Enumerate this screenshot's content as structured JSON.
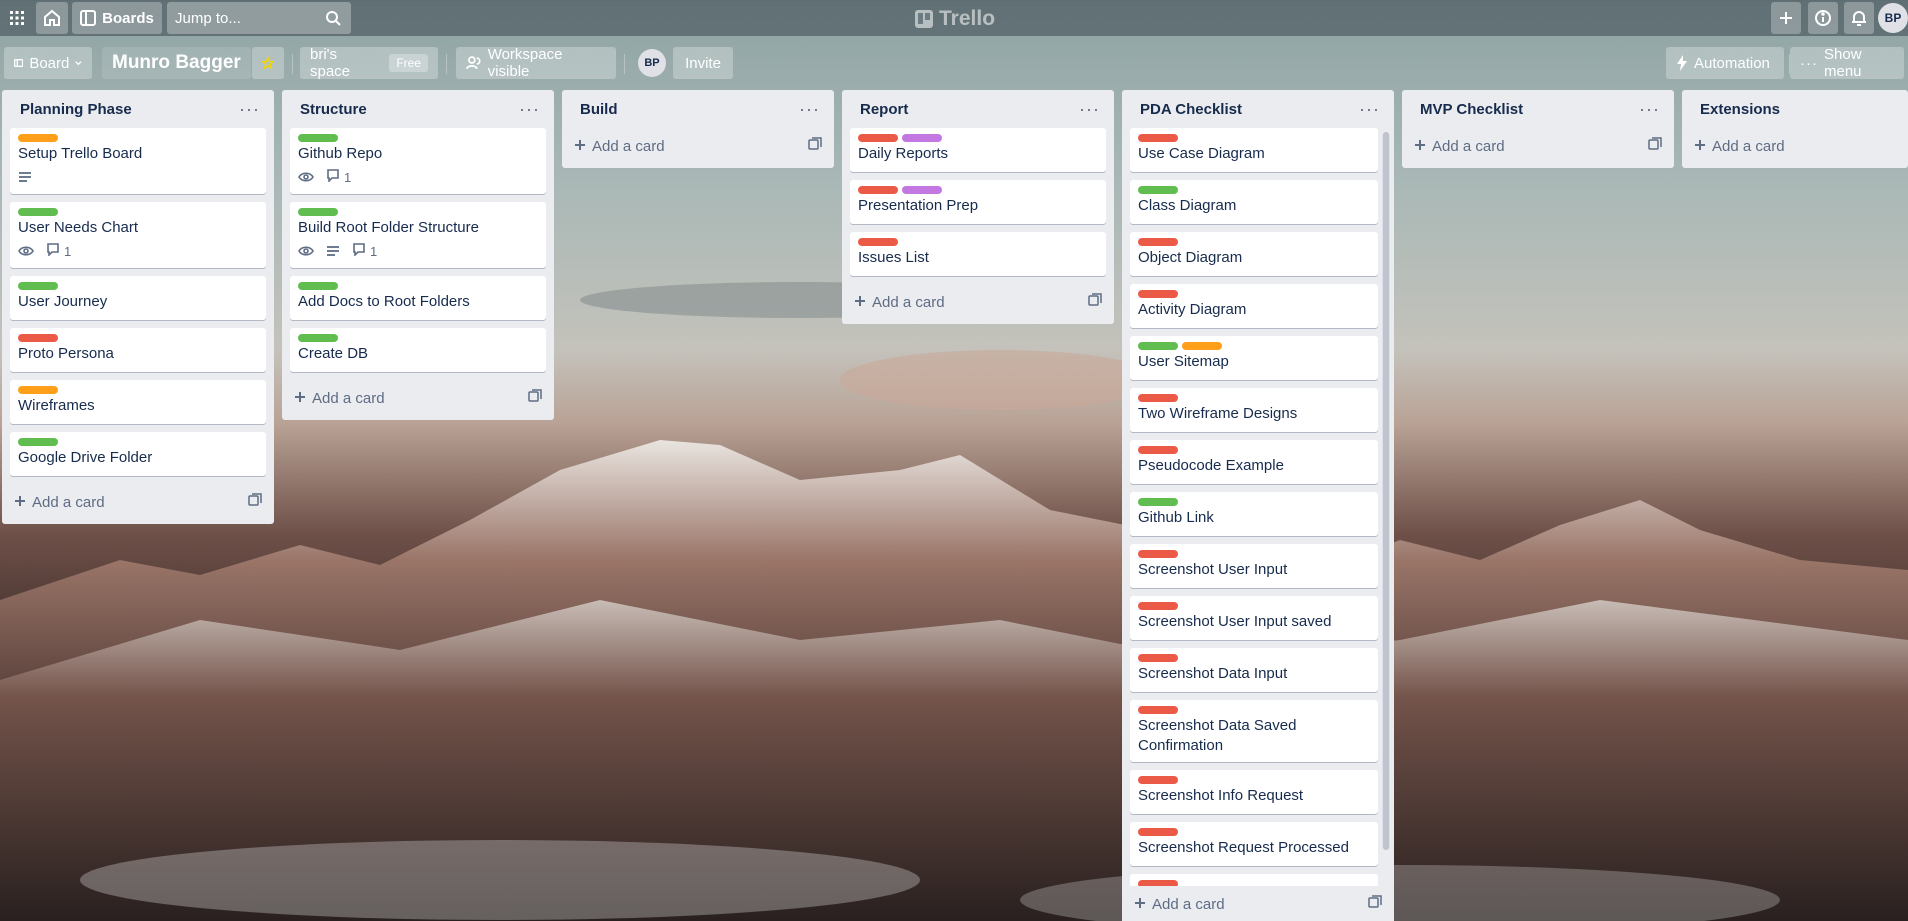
{
  "colors": {
    "green": "#61bd4f",
    "orange": "#ff9f1a",
    "red": "#eb5a46",
    "purple": "#c377e0"
  },
  "topbar": {
    "boards_label": "Boards",
    "search_placeholder": "Jump to...",
    "logo": "Trello",
    "avatar": "BP"
  },
  "boardbar": {
    "view_label": "Board",
    "board_title": "Munro Bagger",
    "workspace_name": "bri's space",
    "plan_badge": "Free",
    "visibility_label": "Workspace visible",
    "member_avatar": "BP",
    "invite_label": "Invite",
    "automation_label": "Automation",
    "show_menu_label": "Show menu"
  },
  "add_card_label": "Add a card",
  "lists": [
    {
      "title": "Planning Phase",
      "cards": [
        {
          "title": "Setup Trello Board",
          "labels": [
            "orange"
          ],
          "description": true,
          "watch": false,
          "comments": ""
        },
        {
          "title": "User Needs Chart",
          "labels": [
            "green"
          ],
          "description": false,
          "watch": true,
          "comments": "1"
        },
        {
          "title": "User Journey",
          "labels": [
            "green"
          ]
        },
        {
          "title": "Proto Persona",
          "labels": [
            "red"
          ]
        },
        {
          "title": "Wireframes",
          "labels": [
            "orange"
          ]
        },
        {
          "title": "Google Drive Folder",
          "labels": [
            "green"
          ]
        }
      ]
    },
    {
      "title": "Structure",
      "cards": [
        {
          "title": "Github Repo",
          "labels": [
            "green"
          ],
          "watch": true,
          "comments": "1"
        },
        {
          "title": "Build Root Folder Structure",
          "labels": [
            "green"
          ],
          "watch": true,
          "description": true,
          "comments": "1"
        },
        {
          "title": "Add Docs to Root Folders",
          "labels": [
            "green"
          ]
        },
        {
          "title": "Create DB",
          "labels": [
            "green"
          ]
        }
      ]
    },
    {
      "title": "Build",
      "cards": []
    },
    {
      "title": "Report",
      "cards": [
        {
          "title": "Daily Reports",
          "labels": [
            "red",
            "purple"
          ]
        },
        {
          "title": "Presentation Prep",
          "labels": [
            "red",
            "purple"
          ]
        },
        {
          "title": "Issues List",
          "labels": [
            "red"
          ]
        }
      ]
    },
    {
      "title": "PDA Checklist",
      "cards": [
        {
          "title": "Use Case Diagram",
          "labels": [
            "red"
          ]
        },
        {
          "title": "Class Diagram",
          "labels": [
            "green"
          ]
        },
        {
          "title": "Object Diagram",
          "labels": [
            "red"
          ]
        },
        {
          "title": "Activity Diagram",
          "labels": [
            "red"
          ]
        },
        {
          "title": "User Sitemap",
          "labels": [
            "green",
            "orange"
          ]
        },
        {
          "title": "Two Wireframe Designs",
          "labels": [
            "red"
          ]
        },
        {
          "title": "Pseudocode Example",
          "labels": [
            "red"
          ]
        },
        {
          "title": "Github Link",
          "labels": [
            "green"
          ]
        },
        {
          "title": "Screenshot User Input",
          "labels": [
            "red"
          ]
        },
        {
          "title": "Screenshot User Input saved",
          "labels": [
            "red"
          ]
        },
        {
          "title": "Screenshot Data Input",
          "labels": [
            "red"
          ]
        },
        {
          "title": "Screenshot Data Saved Confirmation",
          "labels": [
            "red"
          ]
        },
        {
          "title": "Screenshot Info Request",
          "labels": [
            "red"
          ]
        },
        {
          "title": "Screenshot Request Processed",
          "labels": [
            "red"
          ]
        },
        {
          "title": "",
          "labels": [
            "red"
          ]
        }
      ]
    },
    {
      "title": "MVP Checklist",
      "cards": []
    },
    {
      "title": "Extensions",
      "cards": []
    }
  ]
}
